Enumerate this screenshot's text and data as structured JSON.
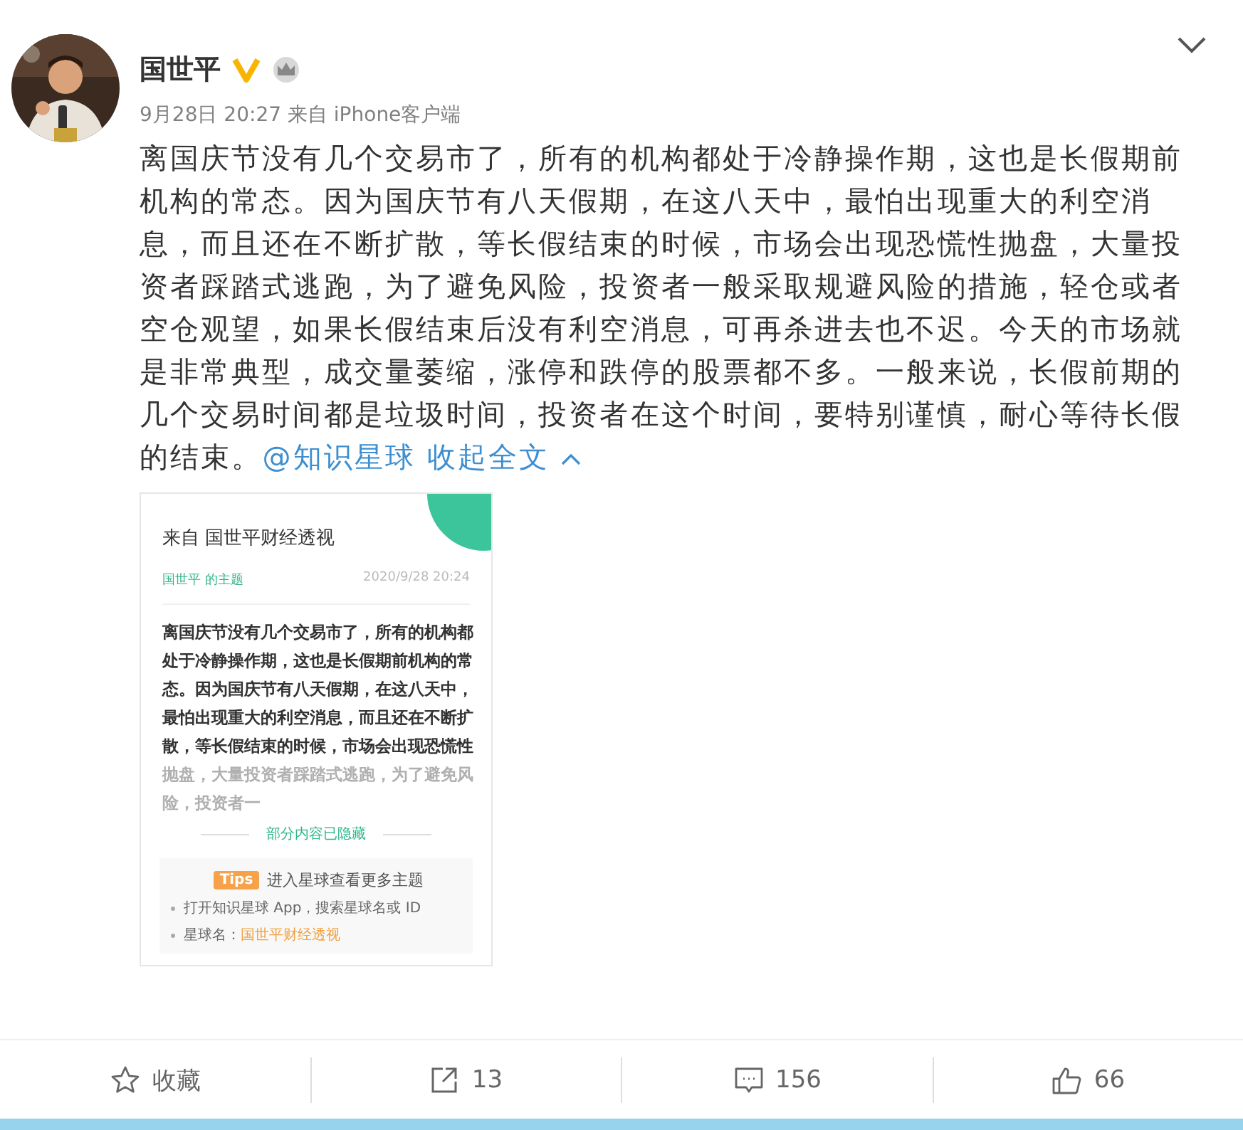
{
  "author": {
    "name": "国世平",
    "verified": true,
    "meta": "9月28日 20:27 来自 iPhone客户端"
  },
  "post": {
    "text": "离国庆节没有几个交易市了，所有的机构都处于冷静操作期，这也是长假期前机构的常态。因为国庆节有八天假期，在这八天中，最怕出现重大的利空消息，而且还在不断扩散，等长假结束的时候，市场会出现恐慌性抛盘，大量投资者踩踏式逃跑，为了避免风险，投资者一般采取规避风险的措施，轻仓或者空仓观望，如果长假结束后没有利空消息，可再杀进去也不迟。今天的市场就是非常典型，成交量萎缩，涨停和跌停的股票都不多。一般来说，长假前期的几个交易时间都是垃圾时间，投资者在这个时间，要特别谨慎，耐心等待长假的结束。",
    "mention": "@知识星球",
    "collapse": "收起全文"
  },
  "attachment": {
    "title": "来自 国世平财经透视",
    "topic": "国世平 的主题",
    "date": "2020/9/28 20:24",
    "paragraph": "离国庆节没有几个交易市了，所有的机构都处于冷静操作期，这也是长假期前机构的常态。因为国庆节有八天假期，在这八天中，最怕出现重大的利空消息，而且还在不断扩散，等长假结束的时候，市场会出现恐慌性",
    "faded": "抛盘，大量投资者踩踏式逃跑，为了避免风险，投资者一",
    "hidden_notice": "部分内容已隐藏",
    "tips_badge": "Tips",
    "tips_title": "进入星球查看更多主题",
    "tips": [
      {
        "text": "打开知识星球 App，搜索星球名或 ID"
      },
      {
        "text": "星球名：",
        "value": "国世平财经透视"
      }
    ]
  },
  "actions": [
    {
      "kind": "favorite",
      "label": "收藏"
    },
    {
      "kind": "repost",
      "label": "13"
    },
    {
      "kind": "comment",
      "label": "156"
    },
    {
      "kind": "like",
      "label": "66"
    }
  ]
}
